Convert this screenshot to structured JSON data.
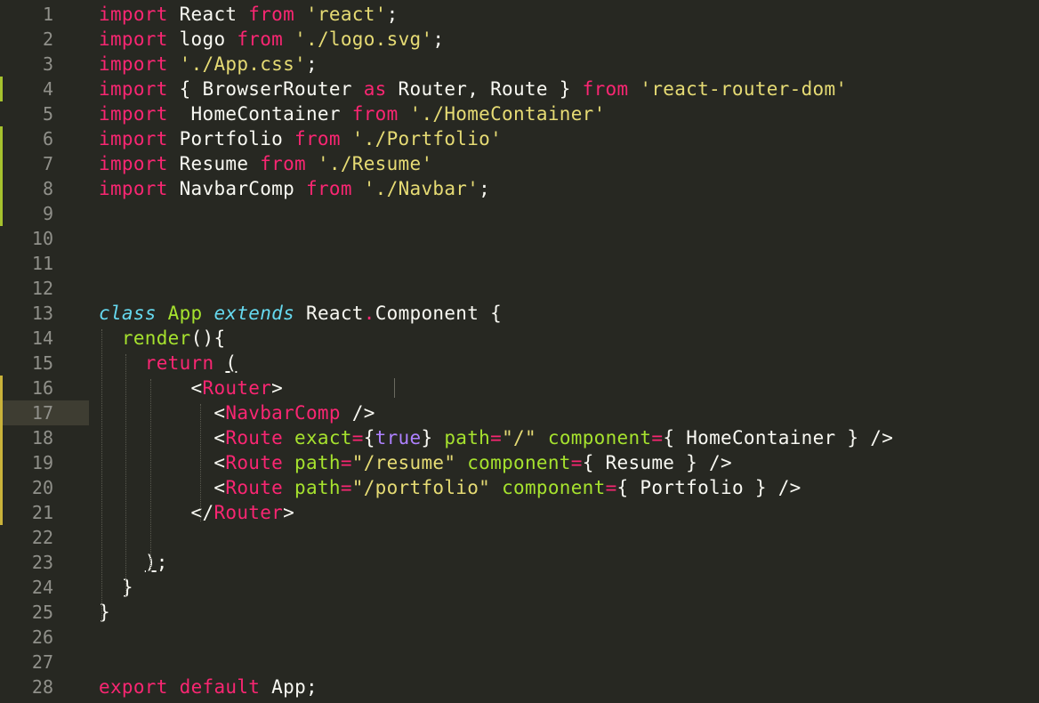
{
  "editor": {
    "active_line": 17,
    "lines": [
      {
        "n": "1",
        "mark": "",
        "tokens": [
          [
            "kw",
            "import"
          ],
          [
            "pl",
            " React "
          ],
          [
            "kw",
            "from"
          ],
          [
            "pl",
            " "
          ],
          [
            "str",
            "'react'"
          ],
          [
            "pl",
            ";"
          ]
        ]
      },
      {
        "n": "2",
        "mark": "",
        "tokens": [
          [
            "kw",
            "import"
          ],
          [
            "pl",
            " logo "
          ],
          [
            "kw",
            "from"
          ],
          [
            "pl",
            " "
          ],
          [
            "str",
            "'./logo.svg'"
          ],
          [
            "pl",
            ";"
          ]
        ]
      },
      {
        "n": "3",
        "mark": "",
        "tokens": [
          [
            "kw",
            "import"
          ],
          [
            "pl",
            " "
          ],
          [
            "str",
            "'./App.css'"
          ],
          [
            "pl",
            ";"
          ]
        ]
      },
      {
        "n": "4",
        "mark": "green",
        "tokens": [
          [
            "kw",
            "import"
          ],
          [
            "pl",
            " { BrowserRouter "
          ],
          [
            "kw",
            "as"
          ],
          [
            "pl",
            " Router, Route } "
          ],
          [
            "kw",
            "from"
          ],
          [
            "pl",
            " "
          ],
          [
            "str",
            "'react-router-dom'"
          ]
        ]
      },
      {
        "n": "5",
        "mark": "",
        "tokens": [
          [
            "kw",
            "import"
          ],
          [
            "pl",
            "  HomeContainer "
          ],
          [
            "kw",
            "from"
          ],
          [
            "pl",
            " "
          ],
          [
            "str",
            "'./HomeContainer'"
          ]
        ]
      },
      {
        "n": "6",
        "mark": "green",
        "tokens": [
          [
            "kw",
            "import"
          ],
          [
            "pl",
            " Portfolio "
          ],
          [
            "kw",
            "from"
          ],
          [
            "pl",
            " "
          ],
          [
            "str",
            "'./Portfolio'"
          ]
        ]
      },
      {
        "n": "7",
        "mark": "green",
        "tokens": [
          [
            "kw",
            "import"
          ],
          [
            "pl",
            " Resume "
          ],
          [
            "kw",
            "from"
          ],
          [
            "pl",
            " "
          ],
          [
            "str",
            "'./Resume'"
          ]
        ]
      },
      {
        "n": "8",
        "mark": "green",
        "tokens": [
          [
            "kw",
            "import"
          ],
          [
            "pl",
            " NavbarComp "
          ],
          [
            "kw",
            "from"
          ],
          [
            "pl",
            " "
          ],
          [
            "str",
            "'./Navbar'"
          ],
          [
            "pl",
            ";"
          ]
        ]
      },
      {
        "n": "9",
        "mark": "green",
        "tokens": []
      },
      {
        "n": "10",
        "mark": "",
        "tokens": []
      },
      {
        "n": "11",
        "mark": "",
        "tokens": []
      },
      {
        "n": "12",
        "mark": "",
        "tokens": []
      },
      {
        "n": "13",
        "mark": "",
        "tokens": [
          [
            "cls",
            "class"
          ],
          [
            "pl",
            " "
          ],
          [
            "ent",
            "App"
          ],
          [
            "pl",
            " "
          ],
          [
            "cls",
            "extends"
          ],
          [
            "pl",
            " React"
          ],
          [
            "kw",
            "."
          ],
          [
            "pl",
            "Component {"
          ]
        ]
      },
      {
        "n": "14",
        "mark": "",
        "tokens": [
          [
            "pl",
            "  "
          ],
          [
            "ent",
            "render"
          ],
          [
            "pl",
            "(){"
          ]
        ]
      },
      {
        "n": "15",
        "mark": "",
        "tokens": [
          [
            "pl",
            "    "
          ],
          [
            "kw",
            "return"
          ],
          [
            "pl",
            " "
          ],
          [
            "ul",
            "("
          ]
        ]
      },
      {
        "n": "16",
        "mark": "yel",
        "tokens": [
          [
            "pl",
            "        <"
          ],
          [
            "tag",
            "Router"
          ],
          [
            "pl",
            ">"
          ]
        ]
      },
      {
        "n": "17",
        "mark": "yel",
        "tokens": [
          [
            "pl",
            "          <"
          ],
          [
            "tag",
            "NavbarComp"
          ],
          [
            "pl",
            " />"
          ]
        ]
      },
      {
        "n": "18",
        "mark": "yel",
        "tokens": [
          [
            "pl",
            "          <"
          ],
          [
            "tag",
            "Route"
          ],
          [
            "pl",
            " "
          ],
          [
            "attr",
            "exact"
          ],
          [
            "kw",
            "="
          ],
          [
            "pl",
            "{"
          ],
          [
            "const",
            "true"
          ],
          [
            "pl",
            "} "
          ],
          [
            "attr",
            "path"
          ],
          [
            "kw",
            "="
          ],
          [
            "str",
            "\"/\""
          ],
          [
            "pl",
            " "
          ],
          [
            "attr",
            "component"
          ],
          [
            "kw",
            "="
          ],
          [
            "pl",
            "{ HomeContainer } />"
          ]
        ]
      },
      {
        "n": "19",
        "mark": "yel",
        "tokens": [
          [
            "pl",
            "          <"
          ],
          [
            "tag",
            "Route"
          ],
          [
            "pl",
            " "
          ],
          [
            "attr",
            "path"
          ],
          [
            "kw",
            "="
          ],
          [
            "str",
            "\"/resume\""
          ],
          [
            "pl",
            " "
          ],
          [
            "attr",
            "component"
          ],
          [
            "kw",
            "="
          ],
          [
            "pl",
            "{ Resume } />"
          ]
        ]
      },
      {
        "n": "20",
        "mark": "yel",
        "tokens": [
          [
            "pl",
            "          <"
          ],
          [
            "tag",
            "Route"
          ],
          [
            "pl",
            " "
          ],
          [
            "attr",
            "path"
          ],
          [
            "kw",
            "="
          ],
          [
            "str",
            "\"/portfolio\""
          ],
          [
            "pl",
            " "
          ],
          [
            "attr",
            "component"
          ],
          [
            "kw",
            "="
          ],
          [
            "pl",
            "{ Portfolio } />"
          ]
        ]
      },
      {
        "n": "21",
        "mark": "yel",
        "tokens": [
          [
            "pl",
            "        </"
          ],
          [
            "tag",
            "Router"
          ],
          [
            "pl",
            ">"
          ]
        ]
      },
      {
        "n": "22",
        "mark": "",
        "tokens": []
      },
      {
        "n": "23",
        "mark": "",
        "tokens": [
          [
            "pl",
            "    "
          ],
          [
            "ul",
            ")"
          ],
          [
            "pl",
            ";"
          ]
        ]
      },
      {
        "n": "24",
        "mark": "",
        "tokens": [
          [
            "pl",
            "  }"
          ]
        ]
      },
      {
        "n": "25",
        "mark": "",
        "tokens": [
          [
            "pl",
            "}"
          ]
        ]
      },
      {
        "n": "26",
        "mark": "",
        "tokens": []
      },
      {
        "n": "27",
        "mark": "",
        "tokens": []
      },
      {
        "n": "28",
        "mark": "",
        "tokens": [
          [
            "kw",
            "export"
          ],
          [
            "pl",
            " "
          ],
          [
            "kw",
            "default"
          ],
          [
            "pl",
            " App;"
          ]
        ]
      }
    ]
  },
  "colors": {
    "background": "#272822",
    "keyword": "#f92672",
    "string": "#e6db74",
    "storage": "#66d9ef",
    "entity": "#a6e22e",
    "constant": "#ae81ff",
    "plain": "#f8f8f2",
    "gutter_text": "#90908a",
    "git_added": "#a6c22e",
    "git_modified": "#c9b23a"
  }
}
